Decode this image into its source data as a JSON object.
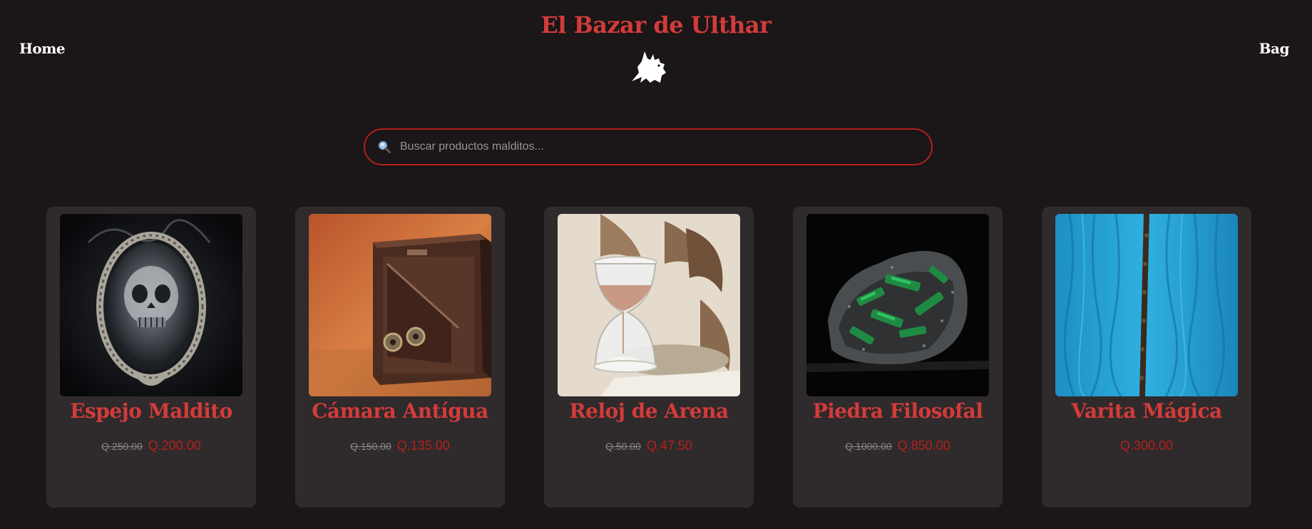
{
  "header": {
    "home_label": "Home",
    "bag_label": "Bag",
    "title": "El Bazar de Ulthar"
  },
  "search": {
    "placeholder": "Buscar productos malditos...",
    "value": ""
  },
  "products": [
    {
      "name": "Espejo Maldito",
      "old_price": "Q.250.00",
      "price": "Q.200.00",
      "image_icon": "cursed-mirror-skull"
    },
    {
      "name": "Cámara Antígua",
      "old_price": "Q.150.00",
      "price": "Q.135.00",
      "image_icon": "antique-camera"
    },
    {
      "name": "Reloj de Arena",
      "old_price": "Q.50.00",
      "price": "Q.47.50",
      "image_icon": "hourglass"
    },
    {
      "name": "Piedra Filosofal",
      "old_price": "Q.1000.00",
      "price": "Q.850.00",
      "image_icon": "green-crystal-stone"
    },
    {
      "name": "Varita Mágica",
      "old_price": "",
      "price": "Q.300.00",
      "image_icon": "wand-on-blue-cloth"
    }
  ],
  "colors": {
    "background": "#1b1617",
    "card": "#2f2a2b",
    "accent": "#d33b3b",
    "price": "#b3201c",
    "search_border": "#b3201c"
  }
}
